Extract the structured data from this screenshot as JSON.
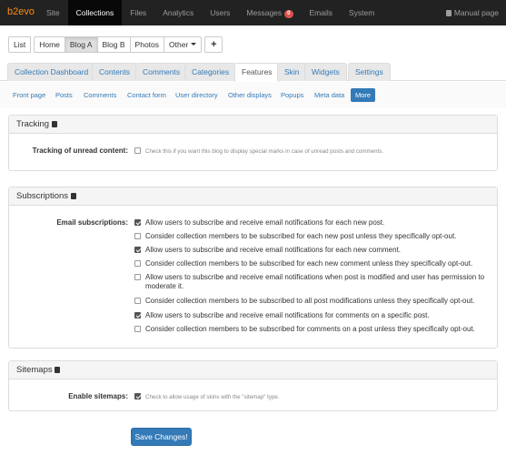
{
  "topbar": {
    "brand": "b2evo",
    "items": [
      {
        "label": "Site"
      },
      {
        "label": "Collections"
      },
      {
        "label": "Files"
      },
      {
        "label": "Analytics"
      },
      {
        "label": "Users"
      },
      {
        "label": "Messages",
        "badge": "0"
      },
      {
        "label": "Emails"
      },
      {
        "label": "System"
      }
    ],
    "manual_label": "Manual page"
  },
  "collections": {
    "list_label": "List",
    "home_label": "Home",
    "blog_a_label": "Blog A",
    "blog_b_label": "Blog B",
    "photos_label": "Photos",
    "other_label": "Other",
    "add_label": "+"
  },
  "tabs": [
    {
      "label": "Collection Dashboard"
    },
    {
      "label": "Contents"
    },
    {
      "label": "Comments"
    },
    {
      "label": "Categories"
    },
    {
      "label": "Features"
    },
    {
      "label": "Skin"
    },
    {
      "label": "Widgets"
    },
    {
      "label": "Settings"
    }
  ],
  "subtabs": [
    {
      "label": "Front page"
    },
    {
      "label": "Posts"
    },
    {
      "label": "Comments"
    },
    {
      "label": "Contact form"
    },
    {
      "label": "User directory"
    },
    {
      "label": "Other displays"
    },
    {
      "label": "Popups"
    },
    {
      "label": "Meta data"
    },
    {
      "label": "More"
    }
  ],
  "tracking": {
    "title": "Tracking",
    "label": "Tracking of unread content:",
    "note": "Check this if you want this blog to display special marks in case of unread posts and comments.",
    "checked": false
  },
  "subscriptions": {
    "title": "Subscriptions",
    "label": "Email subscriptions:",
    "options": [
      {
        "text": "Allow users to subscribe and receive email notifications for each new post.",
        "checked": true
      },
      {
        "text": "Consider collection members to be subscribed for each new post unless they specifically opt-out.",
        "checked": false
      },
      {
        "text": "Allow users to subscribe and receive email notifications for each new comment.",
        "checked": true
      },
      {
        "text": "Consider collection members to be subscribed for each new comment unless they specifically opt-out.",
        "checked": false
      },
      {
        "text": "Allow users to subscribe and receive email notifications when post is modified and user has permission to moderate it.",
        "checked": false
      },
      {
        "text": "Consider collection members to be subscribed to all post modifications unless they specifically opt-out.",
        "checked": false
      },
      {
        "text": "Allow users to subscribe and receive email notifications for comments on a specific post.",
        "checked": true
      },
      {
        "text": "Consider collection members to be subscribed for comments on a post unless they specifically opt-out.",
        "checked": false
      }
    ]
  },
  "sitemaps": {
    "title": "Sitemaps",
    "label": "Enable sitemaps:",
    "note": "Check to allow usage of skins with the \"sitemap\" type.",
    "checked": true
  },
  "save_label": "Save Changes!"
}
